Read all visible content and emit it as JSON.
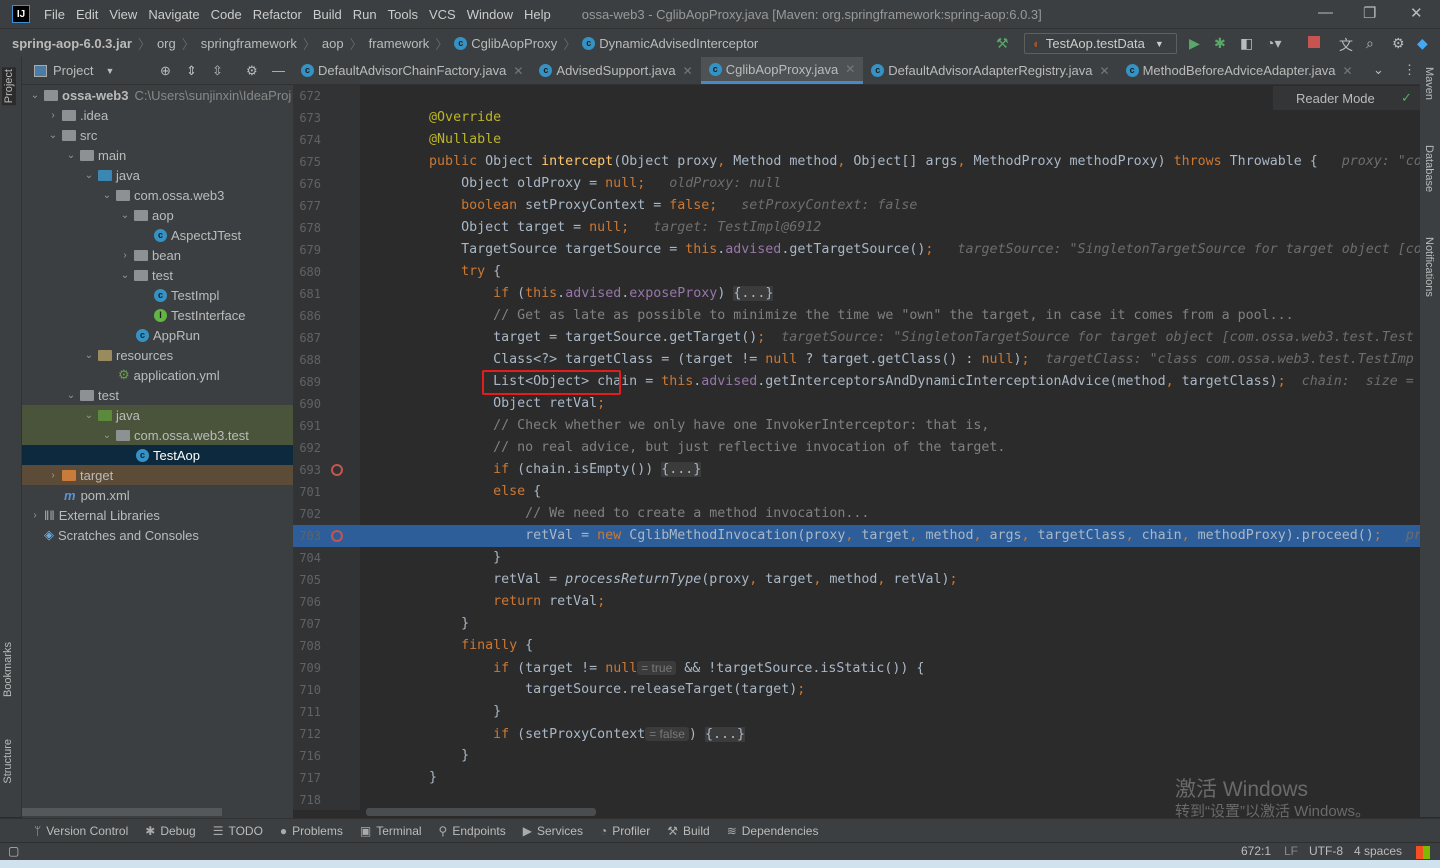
{
  "app": {
    "logo": "IJ",
    "title": "ossa-web3 - CglibAopProxy.java [Maven: org.springframework:spring-aop:6.0.3]",
    "menu": [
      "File",
      "Edit",
      "View",
      "Navigate",
      "Code",
      "Refactor",
      "Build",
      "Run",
      "Tools",
      "VCS",
      "Window",
      "Help"
    ]
  },
  "breadcrumb": [
    "spring-aop-6.0.3.jar",
    "org",
    "springframework",
    "aop",
    "framework",
    "CglibAopProxy",
    "DynamicAdvisedInterceptor"
  ],
  "toolbar": {
    "run_config": "TestAop.testData",
    "icons": [
      "build-hammer-icon",
      "run-icon",
      "debug-icon",
      "coverage-icon",
      "profiler-icon",
      "stop-icon",
      "translate-icon",
      "search-icon",
      "settings-icon",
      "toolbox-icon"
    ]
  },
  "project": {
    "title": "Project",
    "items": [
      {
        "depth": 0,
        "arrow": "v",
        "icon": "module",
        "label": "ossa-web3",
        "path": "C:\\Users\\sunjinxin\\IdeaProj",
        "bold": true
      },
      {
        "depth": 1,
        "arrow": ">",
        "icon": "folder",
        "label": ".idea"
      },
      {
        "depth": 1,
        "arrow": "v",
        "icon": "folder",
        "label": "src"
      },
      {
        "depth": 2,
        "arrow": "v",
        "icon": "folder",
        "label": "main"
      },
      {
        "depth": 3,
        "arrow": "v",
        "icon": "src",
        "label": "java"
      },
      {
        "depth": 4,
        "arrow": "v",
        "icon": "package",
        "label": "com.ossa.web3"
      },
      {
        "depth": 5,
        "arrow": "v",
        "icon": "package",
        "label": "aop"
      },
      {
        "depth": 6,
        "arrow": "",
        "icon": "class",
        "label": "AspectJTest"
      },
      {
        "depth": 5,
        "arrow": ">",
        "icon": "package",
        "label": "bean"
      },
      {
        "depth": 5,
        "arrow": "v",
        "icon": "package",
        "label": "test"
      },
      {
        "depth": 6,
        "arrow": "",
        "icon": "class",
        "label": "TestImpl"
      },
      {
        "depth": 6,
        "arrow": "",
        "icon": "interface",
        "label": "TestInterface"
      },
      {
        "depth": 5,
        "arrow": "",
        "icon": "class",
        "label": "AppRun"
      },
      {
        "depth": 3,
        "arrow": "v",
        "icon": "res",
        "label": "resources"
      },
      {
        "depth": 4,
        "arrow": "",
        "icon": "yaml",
        "label": "application.yml"
      },
      {
        "depth": 2,
        "arrow": "v",
        "icon": "folder",
        "label": "test"
      },
      {
        "depth": 3,
        "arrow": "v",
        "icon": "tfold",
        "label": "java",
        "state": "tst"
      },
      {
        "depth": 4,
        "arrow": "v",
        "icon": "package",
        "label": "com.ossa.web3.test",
        "state": "tst"
      },
      {
        "depth": 5,
        "arrow": "",
        "icon": "class",
        "label": "TestAop",
        "state": "sel"
      },
      {
        "depth": 1,
        "arrow": ">",
        "icon": "exf",
        "label": "target",
        "state": "exc"
      },
      {
        "depth": 1,
        "arrow": "",
        "icon": "maven",
        "label": "pom.xml"
      },
      {
        "depth": 0,
        "arrow": ">",
        "icon": "lib",
        "label": "External Libraries"
      },
      {
        "depth": 0,
        "arrow": "",
        "icon": "scratch",
        "label": "Scratches and Consoles"
      }
    ]
  },
  "tabs": [
    {
      "label": "DefaultAdvisorChainFactory.java"
    },
    {
      "label": "AdvisedSupport.java"
    },
    {
      "label": "CglibAopProxy.java",
      "active": true
    },
    {
      "label": "DefaultAdvisorAdapterRegistry.java"
    },
    {
      "label": "MethodBeforeAdviceAdapter.java"
    }
  ],
  "editor": {
    "reader_mode": "Reader Mode",
    "lines": [
      {
        "num": "672",
        "t": []
      },
      {
        "num": "673",
        "t": [
          [
            "pl",
            "        "
          ],
          [
            "an",
            "@Override"
          ]
        ]
      },
      {
        "num": "674",
        "t": [
          [
            "pl",
            "        "
          ],
          [
            "an",
            "@Nullable"
          ]
        ]
      },
      {
        "num": "675",
        "t": [
          [
            "pl",
            "        "
          ],
          [
            "kw",
            "public "
          ],
          [
            "pl",
            "Object "
          ],
          [
            "fn",
            "intercept"
          ],
          [
            "pl",
            "(Object proxy"
          ],
          [
            "kw",
            ", "
          ],
          [
            "pl",
            "Method method"
          ],
          [
            "kw",
            ", "
          ],
          [
            "pl",
            "Object[] args"
          ],
          [
            "kw",
            ", "
          ],
          [
            "pl",
            "MethodProxy methodProxy) "
          ],
          [
            "kw",
            "throws "
          ],
          [
            "pl",
            "Throwable {  "
          ],
          [
            "hint",
            " proxy: \"com"
          ]
        ]
      },
      {
        "num": "676",
        "t": [
          [
            "pl",
            "            Object oldProxy = "
          ],
          [
            "kw",
            "null;"
          ],
          [
            "hint",
            "   oldProxy: null"
          ]
        ]
      },
      {
        "num": "677",
        "t": [
          [
            "pl",
            "            "
          ],
          [
            "kw",
            "boolean "
          ],
          [
            "pl",
            "setProxyContext = "
          ],
          [
            "kw",
            "false;"
          ],
          [
            "hint",
            "   setProxyContext: false"
          ]
        ]
      },
      {
        "num": "678",
        "t": [
          [
            "pl",
            "            Object target = "
          ],
          [
            "kw",
            "null;"
          ],
          [
            "hint",
            "   target: TestImpl@6912"
          ]
        ]
      },
      {
        "num": "679",
        "t": [
          [
            "pl",
            "            TargetSource targetSource = "
          ],
          [
            "kw",
            "this"
          ],
          [
            "pl",
            "."
          ],
          [
            "fd",
            "advised"
          ],
          [
            "pl",
            ".getTargetSource()"
          ],
          [
            "kw",
            ";"
          ],
          [
            "hint",
            "   targetSource: \"SingletonTargetSource for target object [com"
          ]
        ]
      },
      {
        "num": "680",
        "t": [
          [
            "pl",
            "            "
          ],
          [
            "kw",
            "try "
          ],
          [
            "pl",
            "{"
          ]
        ]
      },
      {
        "num": "681",
        "t": [
          [
            "pl",
            "                "
          ],
          [
            "kw",
            "if "
          ],
          [
            "pl",
            "("
          ],
          [
            "kw",
            "this"
          ],
          [
            "pl",
            "."
          ],
          [
            "fd",
            "advised"
          ],
          [
            "pl",
            "."
          ],
          [
            "fd",
            "exposeProxy"
          ],
          [
            "pl",
            ") "
          ],
          [
            "fb",
            "{...}"
          ]
        ]
      },
      {
        "num": "686",
        "t": [
          [
            "pl",
            "                "
          ],
          [
            "cm",
            "// Get as late as possible to minimize the time we \"own\" the target, in case it comes from a pool..."
          ]
        ]
      },
      {
        "num": "687",
        "t": [
          [
            "pl",
            "                target = targetSource.getTarget()"
          ],
          [
            "kw",
            ";"
          ],
          [
            "hint",
            "  targetSource: \"SingletonTargetSource for target object [com.ossa.web3.test.Test"
          ]
        ]
      },
      {
        "num": "688",
        "t": [
          [
            "pl",
            "                Class<?> targetClass = (target != "
          ],
          [
            "kw",
            "null "
          ],
          [
            "pl",
            "? target.getClass() : "
          ],
          [
            "kw",
            "null"
          ],
          [
            "pl",
            ")"
          ],
          [
            "kw",
            ";"
          ],
          [
            "hint",
            "  targetClass: \"class com.ossa.web3.test.TestImp"
          ]
        ]
      },
      {
        "num": "689",
        "t": [
          [
            "pl",
            "                List<Object> chain = "
          ],
          [
            "kw",
            "this"
          ],
          [
            "pl",
            "."
          ],
          [
            "fd",
            "advised"
          ],
          [
            "pl",
            ".getInterceptorsAndDynamicInterceptionAdvice(method"
          ],
          [
            "kw",
            ", "
          ],
          [
            "pl",
            "targetClass)"
          ],
          [
            "kw",
            ";"
          ],
          [
            "hint",
            "  chain:  size ="
          ]
        ]
      },
      {
        "num": "690",
        "t": [
          [
            "pl",
            "                Object retVal"
          ],
          [
            "kw",
            ";"
          ]
        ]
      },
      {
        "num": "691",
        "t": [
          [
            "pl",
            "                "
          ],
          [
            "cm",
            "// Check whether we only have one InvokerInterceptor: that is,"
          ]
        ]
      },
      {
        "num": "692",
        "t": [
          [
            "pl",
            "                "
          ],
          [
            "cm",
            "// no real advice, but just reflective invocation of the target."
          ]
        ]
      },
      {
        "num": "693",
        "bp": true,
        "t": [
          [
            "pl",
            "                "
          ],
          [
            "kw",
            "if "
          ],
          [
            "pl",
            "(chain.isEmpty()) "
          ],
          [
            "fb",
            "{...}"
          ]
        ]
      },
      {
        "num": "701",
        "t": [
          [
            "pl",
            "                "
          ],
          [
            "kw",
            "else "
          ],
          [
            "pl",
            "{"
          ]
        ]
      },
      {
        "num": "702",
        "t": [
          [
            "pl",
            "                    "
          ],
          [
            "cm",
            "// We need to create a method invocation..."
          ]
        ]
      },
      {
        "num": "703",
        "bp": true,
        "exec": true,
        "t": [
          [
            "pl",
            "                    retVal = "
          ],
          [
            "kw",
            "new "
          ],
          [
            "pl",
            "CglibMethodInvocation(proxy"
          ],
          [
            "kw",
            ", "
          ],
          [
            "pl",
            "target"
          ],
          [
            "kw",
            ", "
          ],
          [
            "pl",
            "method"
          ],
          [
            "kw",
            ", "
          ],
          [
            "pl",
            "args"
          ],
          [
            "kw",
            ", "
          ],
          [
            "pl",
            "targetClass"
          ],
          [
            "kw",
            ", "
          ],
          [
            "pl",
            "chain"
          ],
          [
            "kw",
            ", "
          ],
          [
            "pl",
            "methodProxy).proceed()"
          ],
          [
            "kw",
            ";"
          ],
          [
            "hint",
            "   pro"
          ]
        ]
      },
      {
        "num": "704",
        "t": [
          [
            "pl",
            "                }"
          ]
        ]
      },
      {
        "num": "705",
        "t": [
          [
            "pl",
            "                retVal = "
          ],
          [
            "it",
            "processReturnType"
          ],
          [
            "pl",
            "(proxy"
          ],
          [
            "kw",
            ", "
          ],
          [
            "pl",
            "target"
          ],
          [
            "kw",
            ", "
          ],
          [
            "pl",
            "method"
          ],
          [
            "kw",
            ", "
          ],
          [
            "pl",
            "retVal)"
          ],
          [
            "kw",
            ";"
          ]
        ]
      },
      {
        "num": "706",
        "t": [
          [
            "pl",
            "                "
          ],
          [
            "kw",
            "return "
          ],
          [
            "pl",
            "retVal"
          ],
          [
            "kw",
            ";"
          ]
        ]
      },
      {
        "num": "707",
        "t": [
          [
            "pl",
            "            }"
          ]
        ]
      },
      {
        "num": "708",
        "t": [
          [
            "pl",
            "            "
          ],
          [
            "kw",
            "finally "
          ],
          [
            "pl",
            "{"
          ]
        ]
      },
      {
        "num": "709",
        "t": [
          [
            "pl",
            "                "
          ],
          [
            "kw",
            "if "
          ],
          [
            "pl",
            "(target != "
          ],
          [
            "kw",
            "null"
          ],
          [
            "ih",
            "= true"
          ],
          [
            "pl",
            " && !targetSource.isStatic()) {"
          ]
        ]
      },
      {
        "num": "710",
        "t": [
          [
            "pl",
            "                    targetSource.releaseTarget(target)"
          ],
          [
            "kw",
            ";"
          ]
        ]
      },
      {
        "num": "711",
        "t": [
          [
            "pl",
            "                }"
          ]
        ]
      },
      {
        "num": "712",
        "t": [
          [
            "pl",
            "                "
          ],
          [
            "kw",
            "if "
          ],
          [
            "pl",
            "(setProxyContext"
          ],
          [
            "ih",
            "= false"
          ],
          [
            "pl",
            ") "
          ],
          [
            "fb",
            "{...}"
          ]
        ]
      },
      {
        "num": "716",
        "t": [
          [
            "pl",
            "            }"
          ]
        ]
      },
      {
        "num": "717",
        "t": [
          [
            "pl",
            "        }"
          ]
        ]
      },
      {
        "num": "718",
        "t": []
      }
    ]
  },
  "right_strip": [
    "Maven",
    "Database",
    "Notifications"
  ],
  "left_strip": [
    "Project",
    "Bookmarks",
    "Structure"
  ],
  "bottom_tools": [
    {
      "icon": "version-control-icon",
      "glyph": "ᛘ",
      "label": "Version Control"
    },
    {
      "icon": "debug-icon",
      "glyph": "✱",
      "label": "Debug"
    },
    {
      "icon": "todo-icon",
      "glyph": "☰",
      "label": "TODO"
    },
    {
      "icon": "problems-icon",
      "glyph": "●",
      "label": "Problems"
    },
    {
      "icon": "terminal-icon",
      "glyph": "▣",
      "label": "Terminal"
    },
    {
      "icon": "endpoints-icon",
      "glyph": "⚲",
      "label": "Endpoints"
    },
    {
      "icon": "services-icon",
      "glyph": "▶",
      "label": "Services"
    },
    {
      "icon": "profiler-icon",
      "glyph": "◔",
      "label": "Profiler"
    },
    {
      "icon": "build-icon",
      "glyph": "⚒",
      "label": "Build"
    },
    {
      "icon": "dependencies-icon",
      "glyph": "≋",
      "label": "Dependencies"
    }
  ],
  "status": {
    "position": "672:1",
    "line_sep": "LF",
    "encoding": "UTF-8",
    "indent": "4 spaces"
  },
  "watermark": {
    "line1": "激活 Windows",
    "line2": "转到“设置”以激活 Windows。"
  },
  "colors": {
    "accent": "#4a88c7",
    "exec_line": "#2d5e99",
    "breakpoint": "#c75450",
    "highlight_box": "#e51c1c"
  }
}
